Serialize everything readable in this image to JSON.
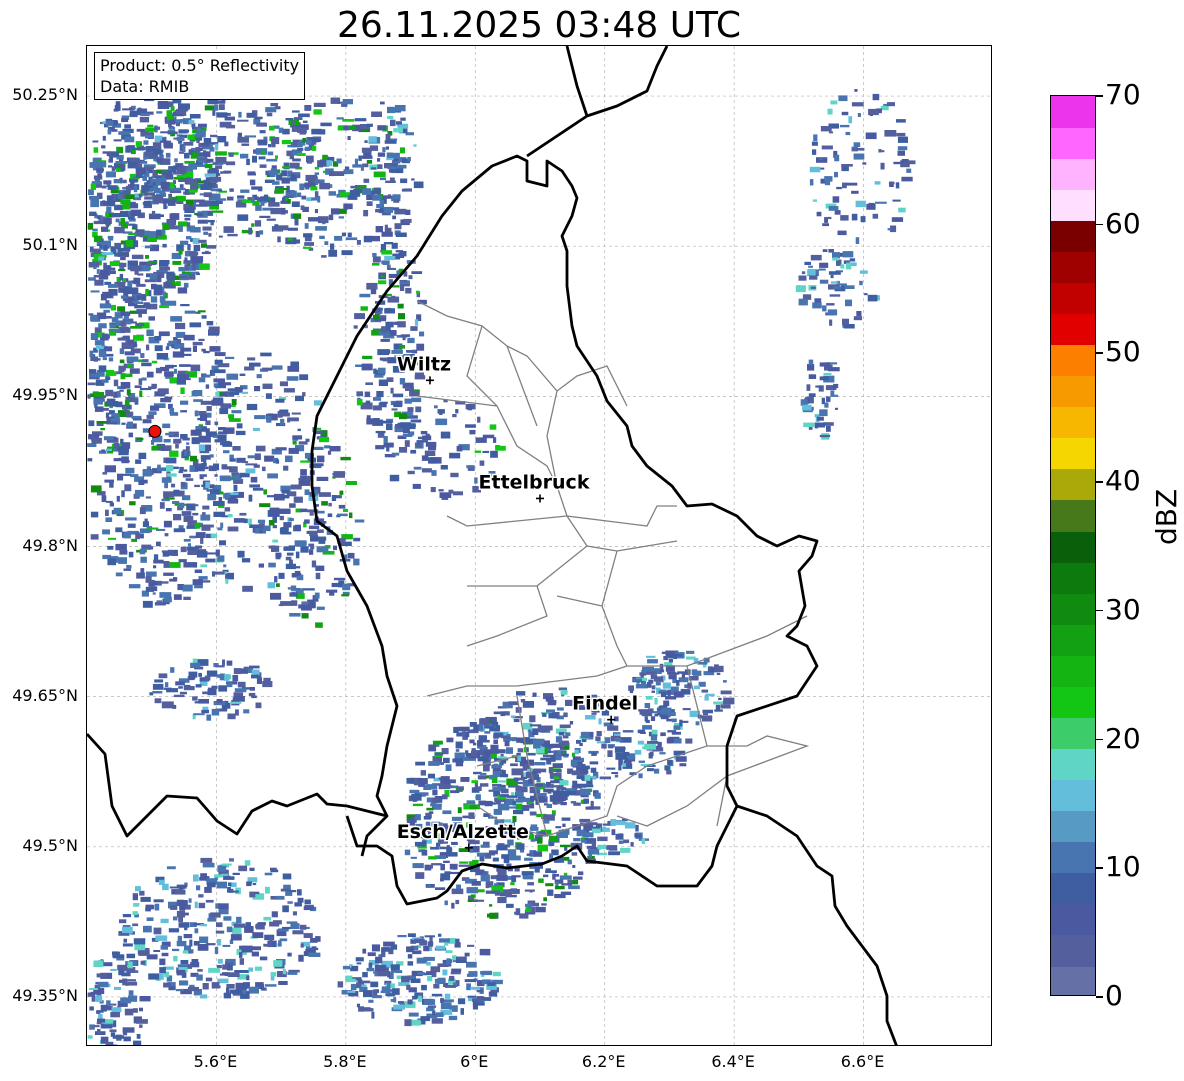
{
  "title": "26.11.2025 03:48 UTC",
  "info_box": {
    "product": "Product: 0.5° Reflectivity",
    "data_source": "Data: RMIB"
  },
  "map": {
    "lat_ticks": [
      "50.25°N",
      "50.1°N",
      "49.95°N",
      "49.8°N",
      "49.65°N",
      "49.5°N",
      "49.35°N"
    ],
    "lat_values": [
      50.25,
      50.1,
      49.95,
      49.8,
      49.65,
      49.5,
      49.35
    ],
    "lon_ticks": [
      "5.6°E",
      "5.8°E",
      "6°E",
      "6.2°E",
      "6.4°E",
      "6.6°E"
    ],
    "lon_values": [
      5.6,
      5.8,
      6.0,
      6.2,
      6.4,
      6.6
    ],
    "extent": {
      "lon_min": 5.4,
      "lon_max": 6.8,
      "lat_min": 49.3,
      "lat_max": 50.3
    },
    "grid": true,
    "cities": [
      {
        "name": "Wiltz",
        "lon": 5.93,
        "lat": 49.966
      },
      {
        "name": "Ettelbruck",
        "lon": 6.1,
        "lat": 49.848
      },
      {
        "name": "Findel",
        "lon": 6.21,
        "lat": 49.627
      },
      {
        "name": "Esch/Alzette",
        "lon": 5.99,
        "lat": 49.499
      }
    ],
    "radar_site": {
      "lon": 5.505,
      "lat": 49.915,
      "color": "#e8120b"
    }
  },
  "colorbar": {
    "unit": "dBZ",
    "min": 0,
    "max": 70,
    "tick_values": [
      0,
      10,
      20,
      30,
      40,
      50,
      60,
      70
    ],
    "tick_labels": [
      "0",
      "10",
      "20",
      "30",
      "40",
      "50",
      "60",
      "70"
    ],
    "colors": [
      "#6470a6",
      "#545f9e",
      "#4a59a0",
      "#3f5ea2",
      "#4874b0",
      "#579bc5",
      "#63bedb",
      "#5ed5c5",
      "#3ccd6a",
      "#14c614",
      "#13b513",
      "#12a112",
      "#108b10",
      "#0d7a0d",
      "#0a600a",
      "#47781a",
      "#a9a90a",
      "#f5d600",
      "#f7b600",
      "#f79a00",
      "#fd7f00",
      "#e00000",
      "#c10000",
      "#9f0000",
      "#7a0000",
      "#ffdfff",
      "#ffb3ff",
      "#ff66ff",
      "#ed34ed"
    ]
  }
}
